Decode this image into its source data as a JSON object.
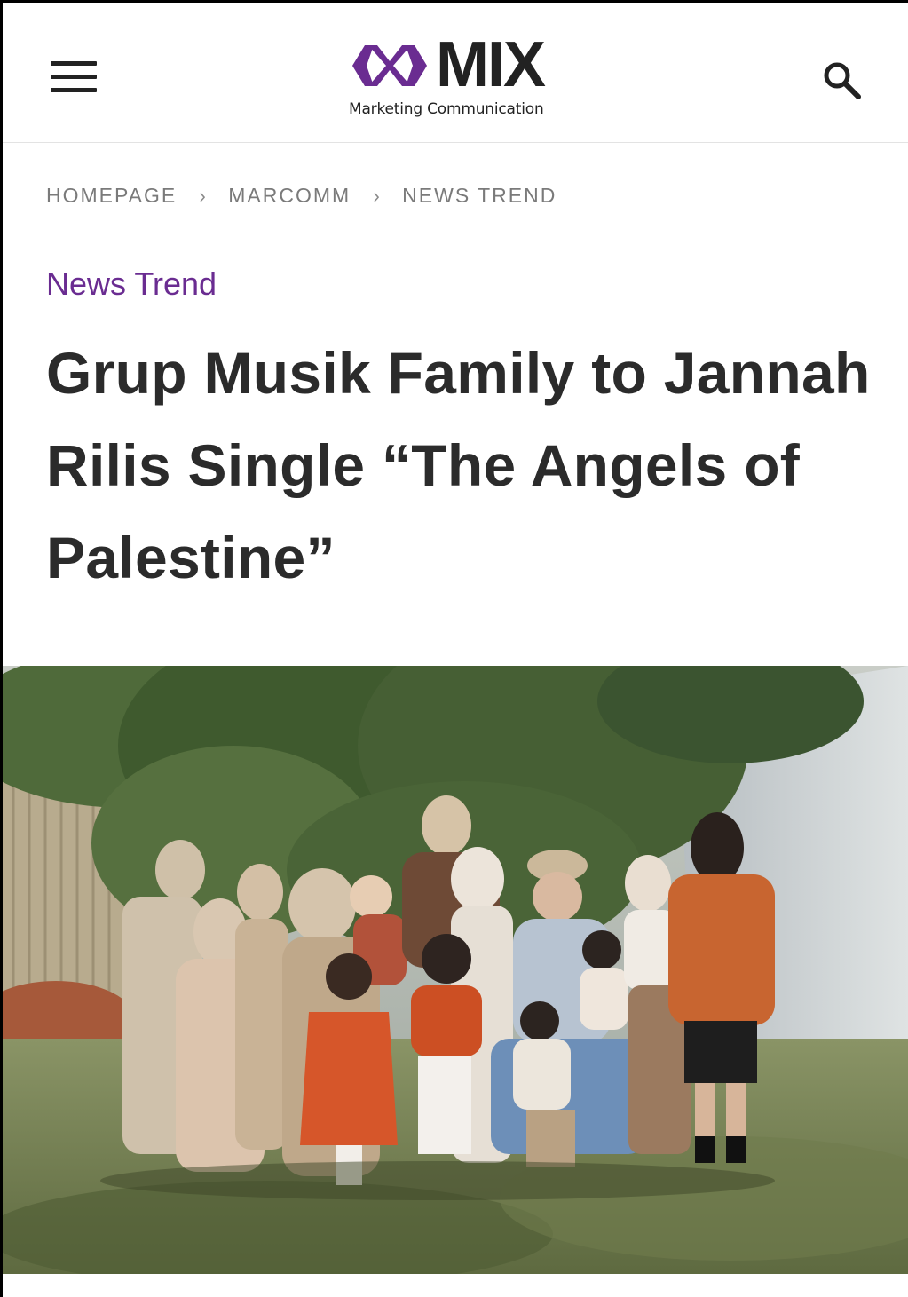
{
  "header": {
    "menu_icon": "hamburger-menu-icon",
    "logo": {
      "wordmark": "MIX",
      "tagline": "Marketing Communication",
      "mark_color": "#6a2c91",
      "text_color": "#222222"
    },
    "search_icon": "search-icon"
  },
  "breadcrumb": {
    "items": [
      "HOMEPAGE",
      "MARCOMM",
      "NEWS TREND"
    ],
    "separator_icon": "chevron-right-icon"
  },
  "article": {
    "category": "News Trend",
    "category_color": "#6a2c91",
    "title": "Grup Musik Family to Jannah Rilis Single “The Angels of Palestine”",
    "hero_image": "family-group-photo"
  }
}
